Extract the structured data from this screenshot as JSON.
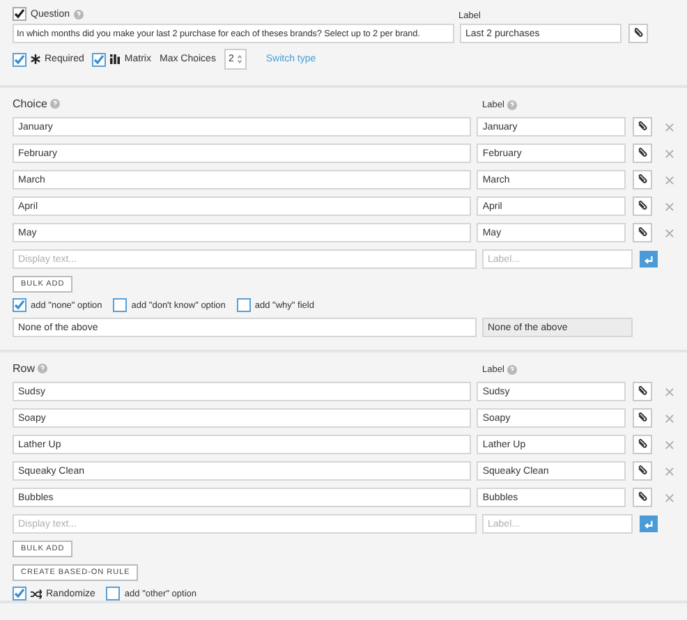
{
  "question": {
    "checked": true,
    "heading": "Question",
    "text": "In which months did you make your last 2 purchase for each of theses brands? Select up to 2 per brand.",
    "label_heading": "Label",
    "label_value": "Last 2 purchases"
  },
  "options": [
    {
      "kind": "required",
      "label": "Required",
      "checked": true
    },
    {
      "kind": "matrix",
      "label": "Matrix",
      "checked": true
    }
  ],
  "max_choices": {
    "label": "Max Choices",
    "value": "2"
  },
  "switch_link": "Switch type",
  "sections": [
    {
      "heading": "Choice",
      "label_heading": "Label",
      "items": [
        {
          "text": "January",
          "label": "January"
        },
        {
          "text": "February",
          "label": "February"
        },
        {
          "text": "March",
          "label": "March"
        },
        {
          "text": "April",
          "label": "April"
        },
        {
          "text": "May",
          "label": "May"
        }
      ],
      "new_item": {
        "placeholder": "Display text...",
        "label_placeholder": "Label..."
      },
      "buttons": [
        "BULK ADD"
      ],
      "extras": [
        {
          "kind": "plain",
          "label": "add \"none\" option",
          "checked": true
        },
        {
          "kind": "plain",
          "label": "add \"don't know\" option",
          "checked": false
        },
        {
          "kind": "plain",
          "label": "add \"why\" field",
          "checked": false
        }
      ],
      "none_item": {
        "text": "None of the above",
        "label": "None of the above",
        "label_disabled": true
      }
    },
    {
      "heading": "Row",
      "label_heading": "Label",
      "items": [
        {
          "text": "Sudsy",
          "label": "Sudsy"
        },
        {
          "text": "Soapy",
          "label": "Soapy"
        },
        {
          "text": "Lather Up",
          "label": "Lather Up"
        },
        {
          "text": "Squeaky Clean",
          "label": "Squeaky Clean"
        },
        {
          "text": "Bubbles",
          "label": "Bubbles"
        }
      ],
      "new_item": {
        "placeholder": "Display text...",
        "label_placeholder": "Label..."
      },
      "buttons": [
        "BULK ADD",
        "CREATE BASED-ON RULE"
      ],
      "extras": [
        {
          "kind": "randomize",
          "label": "Randomize",
          "checked": true
        },
        {
          "kind": "plain",
          "label": "add \"other\" option",
          "checked": false
        }
      ]
    }
  ]
}
